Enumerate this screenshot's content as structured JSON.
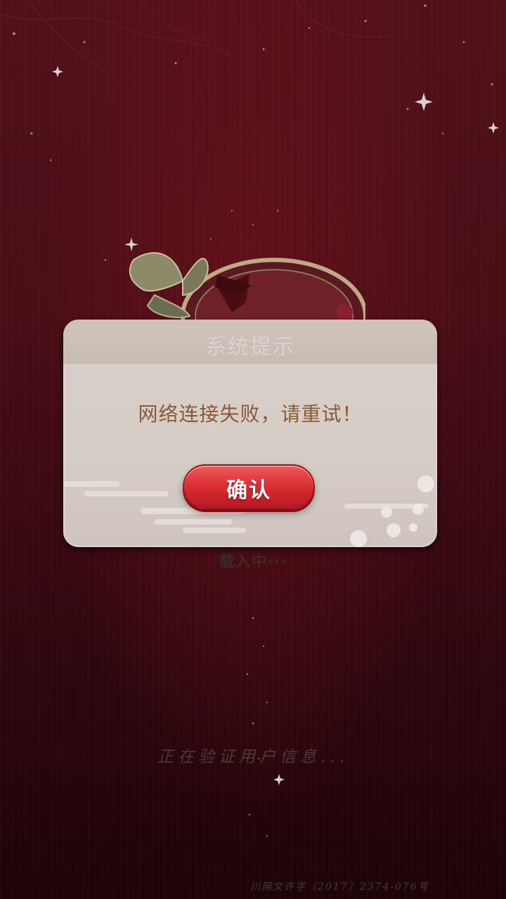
{
  "background": {
    "loading_text": "载入中···",
    "verify_text": "正在验证用户信息...",
    "license_text": "川网文许字〔2017〕2374-076号"
  },
  "dialog": {
    "title": "系统提示",
    "message": "网络连接失败，请重试！",
    "confirm_label": "确认"
  },
  "colors": {
    "background": "#4a0d16",
    "dialog_bg": "#d6ccc6",
    "message_text": "#8a5a35",
    "button_red": "#d82d33"
  },
  "icons": [
    "sparkle-icon",
    "butterfly-icon",
    "flower-icon",
    "cloud-icon"
  ]
}
